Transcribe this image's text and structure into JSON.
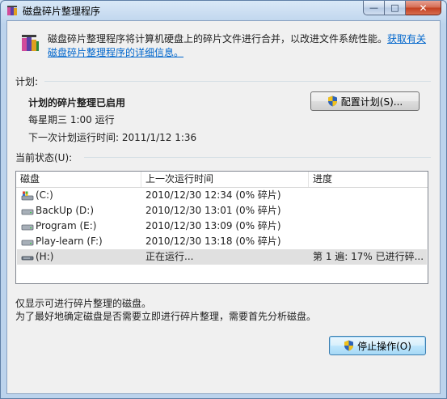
{
  "window": {
    "title": "磁盘碎片整理程序",
    "minimize_glyph": "—",
    "maximize_glyph": "□",
    "close_glyph": "✕"
  },
  "intro": {
    "text": "磁盘碎片整理程序将计算机硬盘上的碎片文件进行合并，以改进文件系统性能。",
    "link": "获取有关磁盘碎片整理程序的详细信息。"
  },
  "schedule": {
    "label": "计划:",
    "enabled_text": "计划的碎片整理已启用",
    "when_text": "每星期三  1:00 运行",
    "next_run_text": "下一次计划运行时间: 2011/1/12 1:36",
    "configure_button": "配置计划(S)..."
  },
  "status": {
    "label": "当前状态(U):",
    "columns": [
      "磁盘",
      "上一次运行时间",
      "进度"
    ],
    "rows": [
      {
        "disk": "(C:)",
        "last_run": "2010/12/30 12:34 (0% 碎片)",
        "progress": "",
        "icon": "system-drive-icon"
      },
      {
        "disk": "BackUp (D:)",
        "last_run": "2010/12/30 13:01 (0% 碎片)",
        "progress": "",
        "icon": "hard-drive-icon"
      },
      {
        "disk": "Program (E:)",
        "last_run": "2010/12/30 13:09 (0% 碎片)",
        "progress": "",
        "icon": "hard-drive-icon"
      },
      {
        "disk": "Play-learn (F:)",
        "last_run": "2010/12/30 13:18 (0% 碎片)",
        "progress": "",
        "icon": "hard-drive-icon"
      },
      {
        "disk": "(H:)",
        "last_run": "正在运行...",
        "progress": "第 1 遍: 17% 已进行碎...",
        "icon": "removable-drive-icon"
      }
    ]
  },
  "notes": {
    "line1": "仅显示可进行碎片整理的磁盘。",
    "line2": "为了最好地确定磁盘是否需要立即进行碎片整理，需要首先分析磁盘。"
  },
  "actions": {
    "stop_button": "停止操作(O)"
  },
  "colors": {
    "link": "#0066cc",
    "selected_row": "#e0e0e0",
    "close_button": "#c33f20"
  }
}
